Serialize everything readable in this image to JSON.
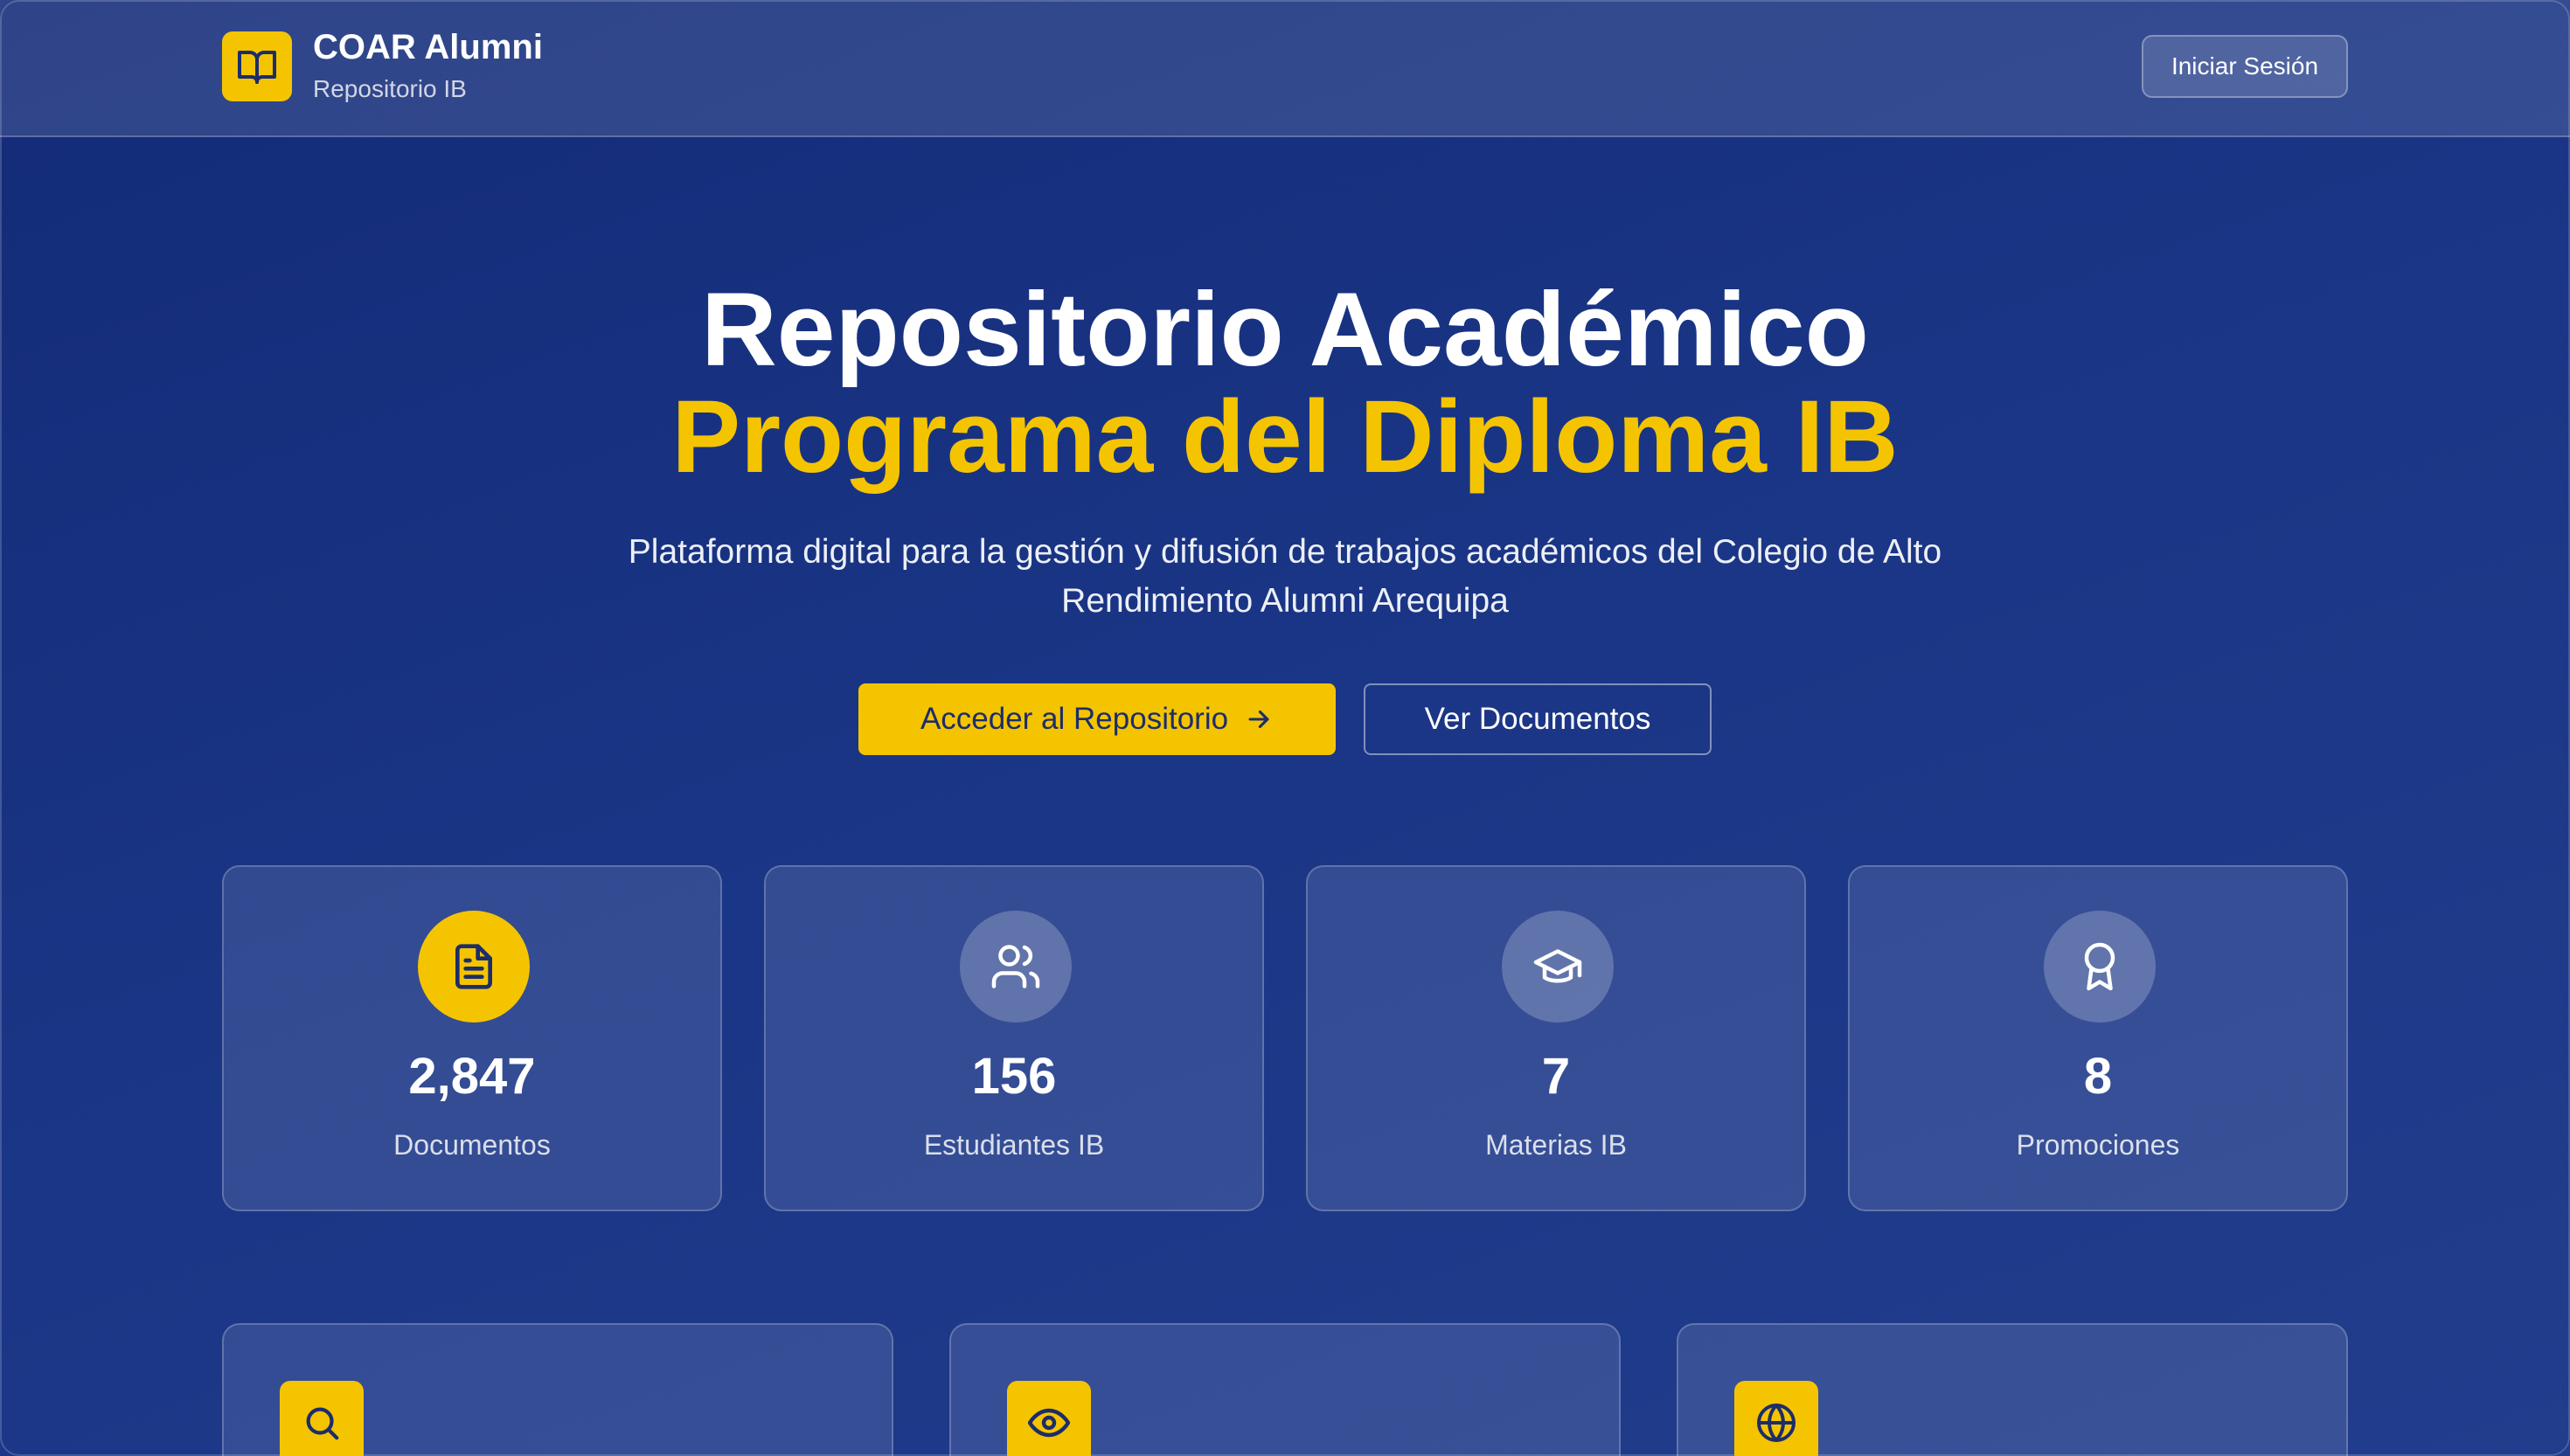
{
  "header": {
    "brand_title": "COAR Alumni",
    "brand_subtitle": "Repositorio IB",
    "logo_icon": "book-open-icon",
    "login_label": "Iniciar Sesión"
  },
  "hero": {
    "title_line1": "Repositorio Académico",
    "title_line2": "Programa del Diploma IB",
    "description": "Plataforma digital para la gestión y difusión de trabajos académicos del Colegio de Alto Rendimiento Alumni Arequipa",
    "primary_button": "Acceder al Repositorio",
    "secondary_button": "Ver Documentos"
  },
  "stats": [
    {
      "value": "2,847",
      "label": "Documentos",
      "icon": "document-icon"
    },
    {
      "value": "156",
      "label": "Estudiantes IB",
      "icon": "users-icon"
    },
    {
      "value": "7",
      "label": "Materias IB",
      "icon": "graduation-cap-icon"
    },
    {
      "value": "8",
      "label": "Promociones",
      "icon": "award-icon"
    }
  ],
  "features": [
    {
      "icon": "search-icon"
    },
    {
      "icon": "eye-icon"
    },
    {
      "icon": "globe-icon"
    }
  ],
  "colors": {
    "background": "#1a3585",
    "accent": "#f5c400",
    "navy_text": "#1c2d6b"
  }
}
